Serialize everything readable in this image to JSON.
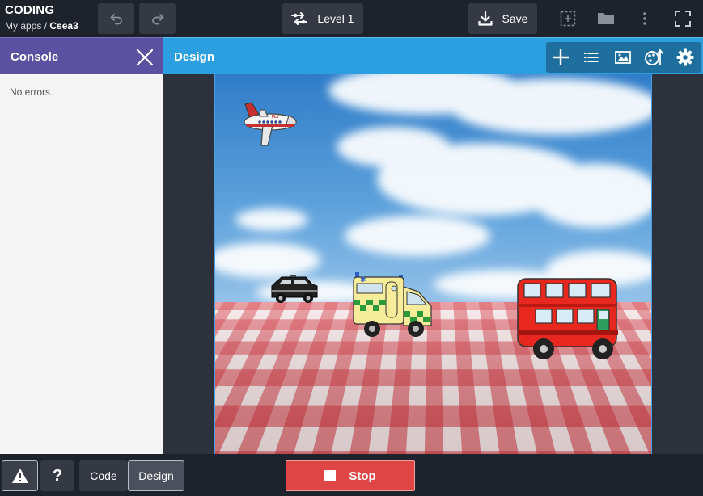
{
  "header": {
    "app_title": "CODING",
    "breadcrumb": {
      "parent": "My apps",
      "separator": " / ",
      "current": "Csea3"
    },
    "level_label": "Level 1",
    "save_label": "Save"
  },
  "console": {
    "title": "Console",
    "message": "No errors."
  },
  "design": {
    "title": "Design"
  },
  "stage": {
    "sprites": [
      {
        "name": "airplane",
        "label": "FLY"
      },
      {
        "name": "taxi"
      },
      {
        "name": "ambulance"
      },
      {
        "name": "bus"
      }
    ]
  },
  "bottom": {
    "code_tab": "Code",
    "design_tab": "Design",
    "help_label": "?",
    "stop_label": "Stop"
  },
  "colors": {
    "console_accent": "#5a51a0",
    "design_accent": "#2c9fe0",
    "stop": "#e04545"
  }
}
